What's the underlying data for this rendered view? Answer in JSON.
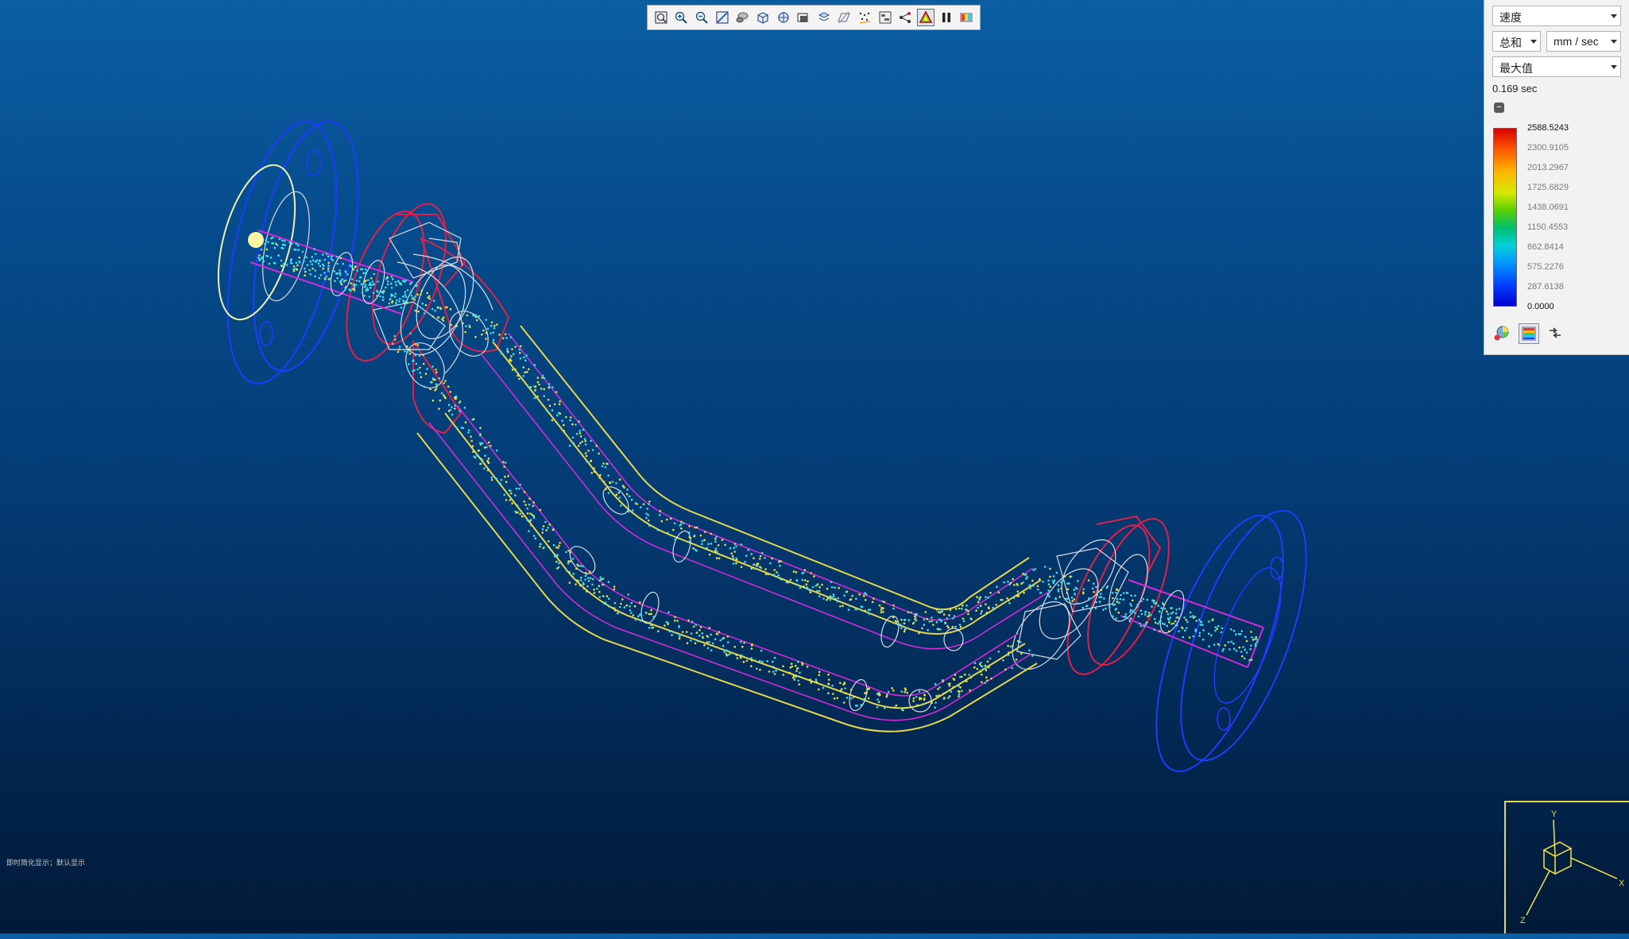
{
  "toolbar": {
    "buttons": [
      {
        "name": "zoom-fit-icon"
      },
      {
        "name": "zoom-in-icon"
      },
      {
        "name": "zoom-out-icon"
      },
      {
        "name": "repaint-icon"
      },
      {
        "name": "render-style-icon"
      },
      {
        "name": "view-cube-icon"
      },
      {
        "name": "saved-views-icon"
      },
      {
        "name": "display-settings-icon"
      },
      {
        "name": "layers-icon"
      },
      {
        "name": "section-plane-icon"
      },
      {
        "name": "particles-icon"
      },
      {
        "name": "model-tree-icon"
      },
      {
        "name": "flow-path-icon"
      },
      {
        "name": "results-triangle-icon",
        "active": true
      },
      {
        "name": "pause-icon"
      },
      {
        "name": "legend-toggle-icon"
      }
    ]
  },
  "results_panel": {
    "quantity": "速度",
    "component": "总和",
    "unit": "mm / sec",
    "mode": "最大值",
    "time": "0.169 sec",
    "collapse_symbol": "−",
    "scale": [
      "2588.5243",
      "2300.9105",
      "2013.2967",
      "1725.6829",
      "1438.0691",
      "1150.4553",
      "862.8414",
      "575.2276",
      "287.6138",
      "0.0000"
    ]
  },
  "status_text": "即时简化显示；默认显示",
  "triad": {
    "x": "X",
    "y": "Y",
    "z": "Z"
  },
  "colors": {
    "flange_outline": "#1e3cff",
    "fitting_outline": "#e0204a",
    "pipe_outer": "#e6d84a",
    "pipe_inner": "#d02cd8",
    "wire": "#d6dde6",
    "particles_primary": "#40e0e8",
    "particles_secondary": "#e8e040",
    "inlet_marker": "#fff6a0"
  }
}
